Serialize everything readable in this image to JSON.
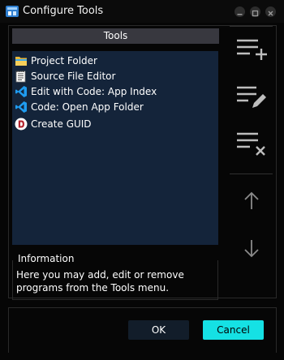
{
  "window": {
    "title": "Configure Tools"
  },
  "tools": {
    "header": "Tools",
    "items": [
      {
        "label": "Project Folder",
        "icon": "folder-icon"
      },
      {
        "label": "Source File Editor",
        "icon": "notepad-icon"
      },
      {
        "label": "Edit with Code: App Index",
        "icon": "vscode-icon"
      },
      {
        "label": "Code: Open App Folder",
        "icon": "vscode-icon"
      },
      {
        "label": "Create GUID",
        "icon": "guid-app-icon"
      }
    ]
  },
  "sidebar": {
    "add_icon": "list-add-icon",
    "edit_icon": "list-edit-icon",
    "remove_icon": "list-remove-icon",
    "up_icon": "arrow-up-icon",
    "down_icon": "arrow-down-icon"
  },
  "information": {
    "label": "Information",
    "text": "Here you may add, edit or remove programs from the Tools menu."
  },
  "buttons": {
    "ok": "OK",
    "cancel": "Cancel"
  },
  "colors": {
    "accent": "#15e1e4",
    "list_bg": "#14243a",
    "header_bg": "#38383f"
  }
}
